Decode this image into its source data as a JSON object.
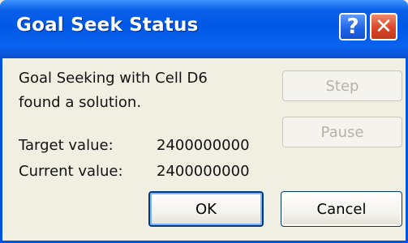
{
  "window": {
    "title": "Goal Seek Status",
    "help_glyph": "?",
    "close_glyph": "✕"
  },
  "message": {
    "line1": "Goal Seeking with Cell D6",
    "line2": "found a solution."
  },
  "values": {
    "target_label": "Target value:",
    "target_value": "2400000000",
    "current_label": "Current value:",
    "current_value": "2400000000"
  },
  "buttons": {
    "step": "Step",
    "pause": "Pause",
    "ok": "OK",
    "cancel": "Cancel"
  },
  "colors": {
    "titlebar": "#0058e6",
    "close_button": "#d9472a",
    "dialog_background": "#f1efe2"
  }
}
